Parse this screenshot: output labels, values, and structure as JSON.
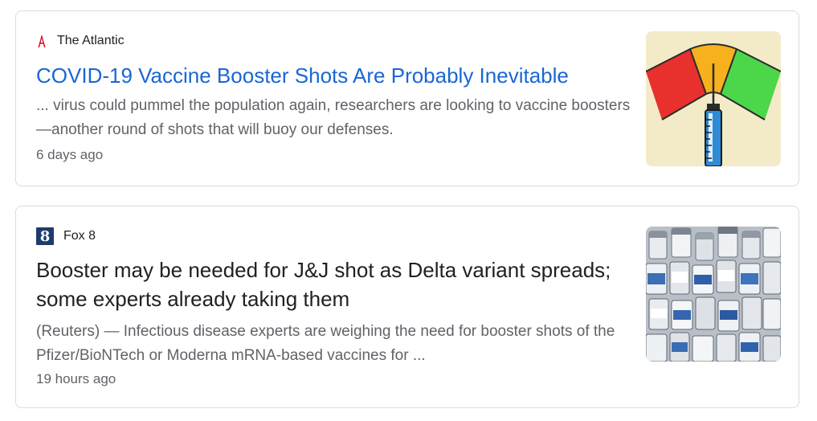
{
  "results": [
    {
      "source": "The Atlantic",
      "source_logo": "atlantic-logo-icon",
      "title": "COVID-19 Vaccine Booster Shots Are Probably Inevitable",
      "snippet": "... virus could pummel the population again, researchers are looking to vaccine boosters—another round of shots that will buoy our defenses.",
      "time": "6 days ago",
      "thumbnail": "vaccine-gauge-illustration",
      "title_color": "#1967d2"
    },
    {
      "source": "Fox 8",
      "source_logo": "fox8-logo-icon",
      "title": "Booster may be needed for J&J shot as Delta variant spreads; some experts already taking them",
      "snippet": "(Reuters) — Infectious disease experts are weighing the need for booster shots of the Pfizer/BioNTech or Moderna mRNA-based vaccines for ...",
      "time": "19 hours ago",
      "thumbnail": "vaccine-vials-photo",
      "title_color": "#202124"
    }
  ]
}
